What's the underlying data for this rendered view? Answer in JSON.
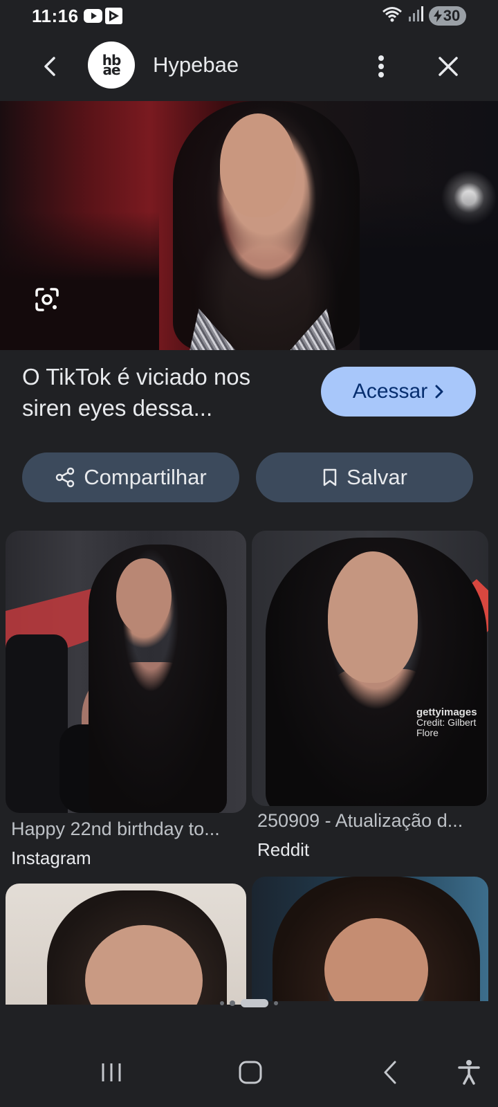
{
  "status_bar": {
    "time": "11:16",
    "battery": "30",
    "icons": [
      "youtube-icon",
      "play-store-icon",
      "wifi-icon",
      "signal-icon",
      "battery-icon"
    ]
  },
  "app_bar": {
    "logo_text": "hb ae",
    "site_name": "Hypebae",
    "icons": [
      "back-arrow-icon",
      "more-vert-icon",
      "close-icon"
    ]
  },
  "result": {
    "title": "O TikTok é viciado nos siren eyes dessa...",
    "visit_label": "Acessar"
  },
  "actions": {
    "share_label": "Compartilhar",
    "save_label": "Salvar"
  },
  "cards": [
    {
      "caption": "Happy 22nd birthday to...",
      "source": "Instagram"
    },
    {
      "caption": "250909 - Atualização d...",
      "source": "Reddit",
      "watermark": "gettyimages",
      "credit": "Credit: Gilbert Flore"
    }
  ],
  "colors": {
    "background": "#202124",
    "accent_button": "#a8c7fa",
    "chip_button": "#3c4a5c"
  },
  "pager": {
    "pages": 4,
    "active_index": 2
  }
}
